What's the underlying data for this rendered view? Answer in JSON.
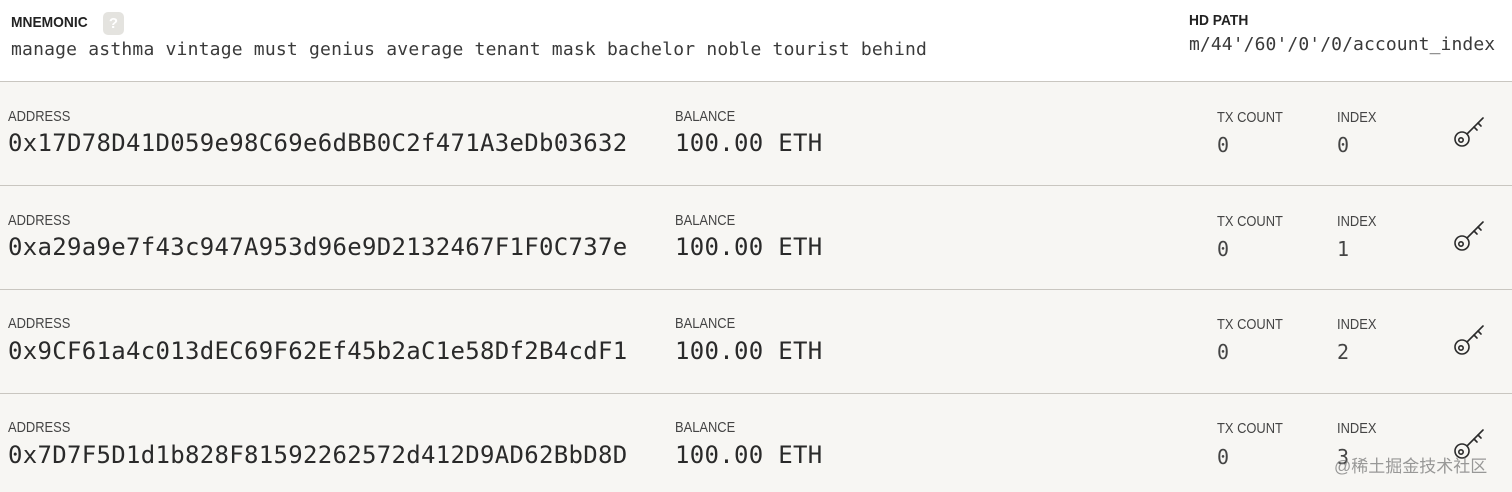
{
  "header": {
    "mnemonic_label": "MNEMONIC",
    "help_symbol": "?",
    "mnemonic_words": "manage asthma vintage must genius average tenant mask bachelor noble tourist behind",
    "hd_path_label": "HD PATH",
    "hd_path_value": "m/44'/60'/0'/0/account_index"
  },
  "labels": {
    "address": "ADDRESS",
    "balance": "BALANCE",
    "tx_count": "TX COUNT",
    "index": "INDEX"
  },
  "accounts": [
    {
      "address": "0x17D78D41D059e98C69e6dBB0C2f471A3eDb03632",
      "balance": "100.00 ETH",
      "tx_count": "0",
      "index": "0"
    },
    {
      "address": "0xa29a9e7f43c947A953d96e9D2132467F1F0C737e",
      "balance": "100.00 ETH",
      "tx_count": "0",
      "index": "1"
    },
    {
      "address": "0x9CF61a4c013dEC69F62Ef45b2aC1e58Df2B4cdF1",
      "balance": "100.00 ETH",
      "tx_count": "0",
      "index": "2"
    },
    {
      "address": "0x7D7F5D1d1b828F81592262572d412D9AD62BbD8D",
      "balance": "100.00 ETH",
      "tx_count": "0",
      "index": "3"
    }
  ],
  "icons": {
    "show_key": "key-icon"
  },
  "watermark": "@稀土掘金技术社区"
}
